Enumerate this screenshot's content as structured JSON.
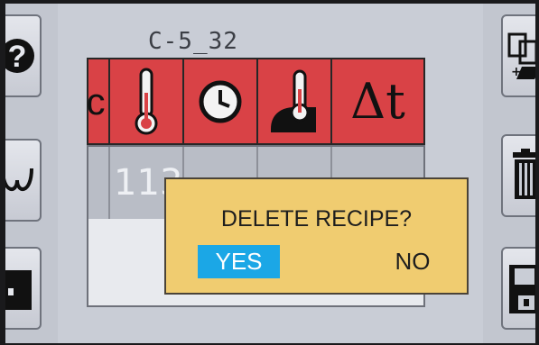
{
  "recipe": {
    "name": "C-5_32"
  },
  "header": {
    "cells": [
      {
        "label": "c",
        "icon": "partial-label"
      },
      {
        "icon": "thermometer-icon"
      },
      {
        "icon": "clock-icon"
      },
      {
        "icon": "core-probe-icon"
      },
      {
        "label": "Δt",
        "icon": "delta-t-icon"
      }
    ]
  },
  "data_row": {
    "visible_value": "113"
  },
  "left_toolbar": [
    "help-icon",
    "fan-cycle-icon",
    "oven-icon"
  ],
  "right_toolbar": [
    "copy-recipe-icon",
    "trash-icon",
    "save-icon"
  ],
  "dialog": {
    "message": "DELETE RECIPE?",
    "yes_label": "YES",
    "no_label": "NO"
  },
  "colors": {
    "header_red": "#d94246",
    "dialog_bg": "#f0cc70",
    "yes_blue": "#1ba7e6"
  }
}
